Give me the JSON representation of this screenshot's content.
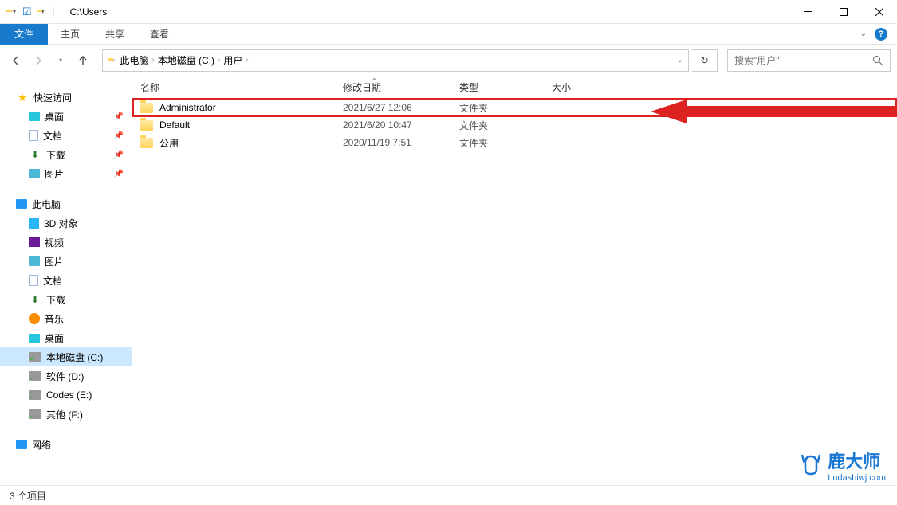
{
  "title_bar": {
    "title": "C:\\Users"
  },
  "menu": {
    "file": "文件",
    "home": "主页",
    "share": "共享",
    "view": "查看"
  },
  "breadcrumb": {
    "pc": "此电脑",
    "drive": "本地磁盘 (C:)",
    "folder": "用户"
  },
  "search": {
    "placeholder": "搜索\"用户\""
  },
  "sidebar": {
    "quick": {
      "header": "快速访问",
      "items": [
        "桌面",
        "文档",
        "下载",
        "图片"
      ]
    },
    "pc": {
      "header": "此电脑",
      "items": [
        "3D 对象",
        "视频",
        "图片",
        "文档",
        "下载",
        "音乐",
        "桌面",
        "本地磁盘 (C:)",
        "软件 (D:)",
        "Codes (E:)",
        "其他 (F:)"
      ]
    },
    "network": "网络"
  },
  "columns": {
    "name": "名称",
    "date": "修改日期",
    "type": "类型",
    "size": "大小"
  },
  "files": [
    {
      "name": "Administrator",
      "date": "2021/6/27 12:06",
      "type": "文件夹"
    },
    {
      "name": "Default",
      "date": "2021/6/20 10:47",
      "type": "文件夹"
    },
    {
      "name": "公用",
      "date": "2020/11/19 7:51",
      "type": "文件夹"
    }
  ],
  "status": {
    "text": "3 个项目"
  },
  "watermark": {
    "cn": "鹿大师",
    "url": "Ludashiwj.com"
  }
}
